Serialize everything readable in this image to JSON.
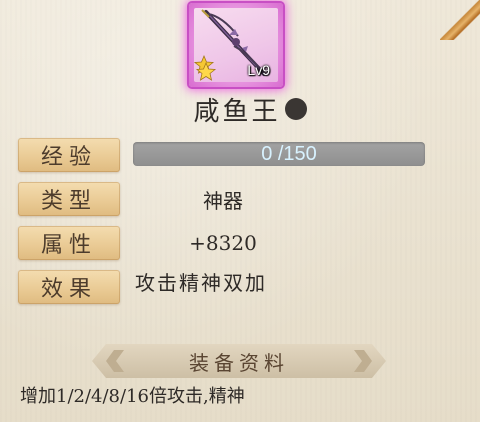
{
  "item": {
    "name": "咸鱼王",
    "level": "Lv9",
    "icon": "bow-weapon-icon",
    "quality_color": "#d86cd0"
  },
  "stats": {
    "experience": {
      "label": "经验",
      "value": "0 /150",
      "current": 0,
      "max": 150
    },
    "type": {
      "label": "类型",
      "value": "神器"
    },
    "attribute": {
      "label": "属性",
      "value": "+8320"
    },
    "effect": {
      "label": "效果",
      "value": "攻击精神双加"
    }
  },
  "section": {
    "title": "装备资料",
    "description": "增加1/2/4/8/16倍攻击,精神"
  },
  "colors": {
    "label_bg": "#e9c993",
    "xp_bar": "#999999",
    "xp_text": "#d8f2ff",
    "glow": "#eb50e1"
  }
}
